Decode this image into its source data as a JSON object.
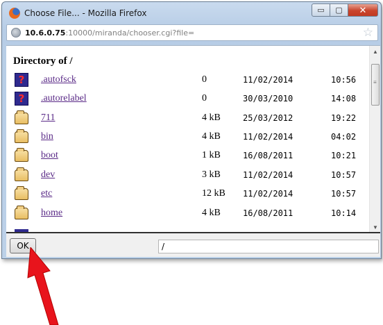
{
  "window": {
    "title": "Choose File... - Mozilla Firefox",
    "buttons": {
      "minimize": "▭",
      "maximize": "▢",
      "close": "✕"
    }
  },
  "urlbar": {
    "host": "10.6.0.75",
    "rest": ":10000/miranda/chooser.cgi?file="
  },
  "listing": {
    "heading": "Directory of /",
    "entries": [
      {
        "name": ".autofsck",
        "size": "0",
        "date": "11/02/2014",
        "time": "10:56",
        "icon": "help-icon"
      },
      {
        "name": ".autorelabel",
        "size": "0",
        "date": "30/03/2010",
        "time": "14:08",
        "icon": "help-icon"
      },
      {
        "name": "711",
        "size": "4 kB",
        "date": "25/03/2012",
        "time": "19:22",
        "icon": "folder-icon"
      },
      {
        "name": "bin",
        "size": "4 kB",
        "date": "11/02/2014",
        "time": "04:02",
        "icon": "folder-icon"
      },
      {
        "name": "boot",
        "size": "1 kB",
        "date": "16/08/2011",
        "time": "10:21",
        "icon": "folder-icon"
      },
      {
        "name": "dev",
        "size": "3 kB",
        "date": "11/02/2014",
        "time": "10:57",
        "icon": "folder-icon"
      },
      {
        "name": "etc",
        "size": "12 kB",
        "date": "11/02/2014",
        "time": "10:57",
        "icon": "folder-icon"
      },
      {
        "name": "home",
        "size": "4 kB",
        "date": "16/08/2011",
        "time": "10:14",
        "icon": "folder-icon"
      }
    ]
  },
  "footer": {
    "ok_label": "OK",
    "path_value": "/"
  },
  "colors": {
    "link": "#5a2a87",
    "arrow": "#e8141c"
  }
}
